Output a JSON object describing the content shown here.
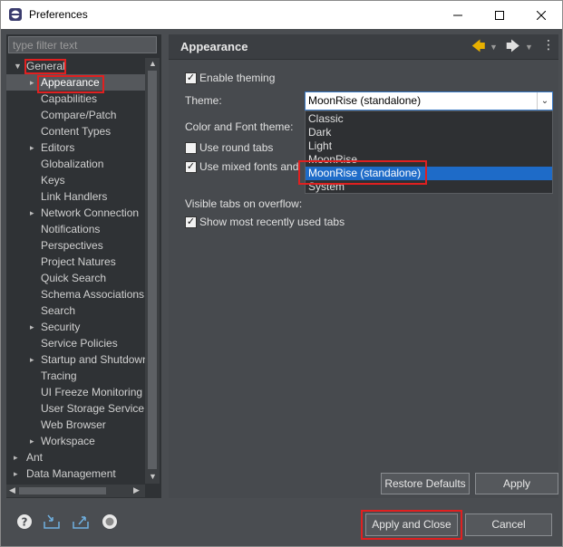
{
  "window": {
    "title": "Preferences"
  },
  "filter": {
    "placeholder": "type filter text"
  },
  "tree": {
    "root": "General",
    "selected": "Appearance",
    "items": [
      "Capabilities",
      "Compare/Patch",
      "Content Types",
      "Editors",
      "Globalization",
      "Keys",
      "Link Handlers",
      "Network Connection",
      "Notifications",
      "Perspectives",
      "Project Natures",
      "Quick Search",
      "Schema Associations",
      "Search",
      "Security",
      "Service Policies",
      "Startup and Shutdown",
      "Tracing",
      "UI Freeze Monitoring",
      "User Storage Service",
      "Web Browser",
      "Workspace"
    ],
    "after": [
      "Ant",
      "Data Management"
    ]
  },
  "page": {
    "title": "Appearance",
    "enable_theming": "Enable theming",
    "theme_label": "Theme:",
    "theme_value": "MoonRise (standalone)",
    "color_font_label": "Color and Font theme:",
    "round_tabs": "Use round tabs",
    "mixed_fonts": "Use mixed fonts and",
    "visible_tabs": "Visible tabs on overflow:",
    "show_recent": "Show most recently used tabs"
  },
  "theme_options": [
    "Classic",
    "Dark",
    "Light",
    "MoonRise",
    "MoonRise (standalone)",
    "System"
  ],
  "buttons": {
    "restore": "Restore Defaults",
    "apply": "Apply",
    "apply_close": "Apply and Close",
    "cancel": "Cancel"
  }
}
